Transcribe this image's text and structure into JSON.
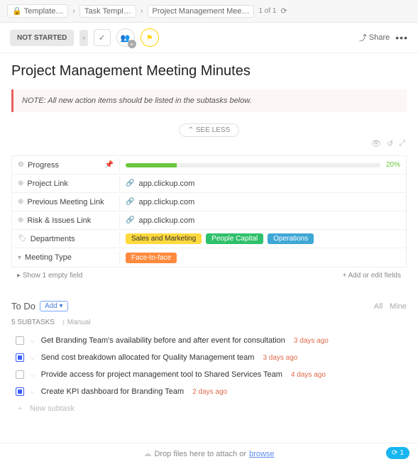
{
  "breadcrumb": {
    "items": [
      "Template…",
      "Task Templ…",
      "Project Management Mee…"
    ],
    "count": "1 of 1"
  },
  "toolbar": {
    "status": "NOT STARTED",
    "share": "Share"
  },
  "title": "Project Management Meeting Minutes",
  "note": "NOTE: All new action items should be listed in the subtasks below.",
  "see_less": "⌃ SEE LESS",
  "fields": {
    "progress": {
      "label": "Progress",
      "pct": "20%"
    },
    "project_link": {
      "label": "Project Link",
      "value": "app.clickup.com"
    },
    "prev_meeting": {
      "label": "Previous Meeting Link",
      "value": "app.clickup.com"
    },
    "risk_issues": {
      "label": "Risk & Issues Link",
      "value": "app.clickup.com"
    },
    "departments": {
      "label": "Departments",
      "tags": [
        "Sales and Marketing",
        "People Capital",
        "Operations"
      ]
    },
    "meeting_type": {
      "label": "Meeting Type",
      "tag": "Face-to-face"
    },
    "footer_left": "Show 1 empty field",
    "footer_right": "+ Add or edit fields"
  },
  "todo": {
    "title": "To Do",
    "add": "Add ▾",
    "filters": {
      "all": "All",
      "mine": "Mine"
    },
    "count": "5 SUBTASKS",
    "sort": "Manual",
    "tasks": [
      {
        "text": "Get Branding Team's availability before and after event for consultation",
        "age": "3 days ago",
        "checked": false
      },
      {
        "text": "Send cost breakdown allocated for Quality Management team",
        "age": "3 days ago",
        "checked": true
      },
      {
        "text": "Provide access for project management tool to Shared Services Team",
        "age": "4 days ago",
        "checked": false
      },
      {
        "text": "Create KPI dashboard for Branding Team",
        "age": "2 days ago",
        "checked": true
      }
    ],
    "new_placeholder": "New subtask"
  },
  "footer": {
    "text": "Drop files here to attach or ",
    "link": "browse",
    "fab": "1"
  }
}
